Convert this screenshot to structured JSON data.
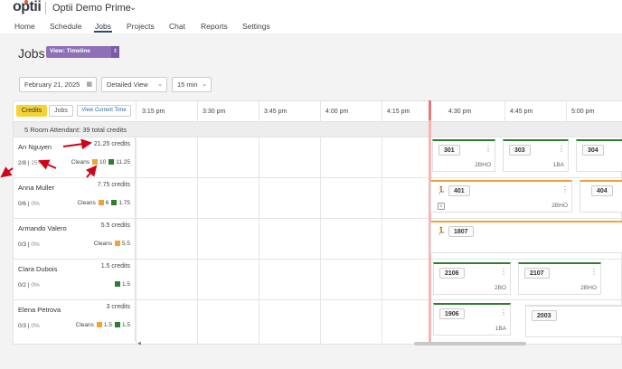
{
  "app": {
    "logo_text": "optii",
    "org_name": "Optii Demo Prime"
  },
  "nav": {
    "items": [
      {
        "label": "Home"
      },
      {
        "label": "Schedule"
      },
      {
        "label": "Jobs"
      },
      {
        "label": "Projects"
      },
      {
        "label": "Chat"
      },
      {
        "label": "Reports"
      },
      {
        "label": "Settings"
      }
    ],
    "active": "Jobs"
  },
  "page": {
    "title": "Jobs",
    "view_label": "View: Timeline"
  },
  "controls": {
    "date": "February 21, 2025",
    "detail": "Detailed View",
    "interval": "15 min"
  },
  "timeline": {
    "tabs": {
      "credits": "Credits",
      "jobs": "Jobs",
      "view_current": "View Current Time"
    },
    "times": [
      "3:15 pm",
      "3:30 pm",
      "3:45 pm",
      "4:00 pm",
      "4:15 pm",
      "4:30 pm",
      "4:45 pm",
      "5:00 pm"
    ],
    "group_label": "5 Room Attendant: 39 total credits",
    "staff": [
      {
        "name": "An Nguyen",
        "credits": "21.25 credits",
        "progress": "2/8",
        "percent": "25%",
        "cleans_label": "Cleans",
        "orange": "10",
        "green": "11.25"
      },
      {
        "name": "Anna Muller",
        "credits": "7.75 credits",
        "progress": "0/6",
        "percent": "0%",
        "cleans_label": "Cleans",
        "orange": "6",
        "green": "1.75"
      },
      {
        "name": "Armando Valero",
        "credits": "5.5 credits",
        "progress": "0/3",
        "percent": "0%",
        "cleans_label": "Cleans",
        "orange": "5.5",
        "green": ""
      },
      {
        "name": "Clara Dubois",
        "credits": "1.5 credits",
        "progress": "0/2",
        "percent": "0%",
        "cleans_label": "",
        "orange": "",
        "green": "1.5"
      },
      {
        "name": "Elena Petrova",
        "credits": "3 credits",
        "progress": "0/3",
        "percent": "0%",
        "cleans_label": "Cleans",
        "orange": "1.5",
        "green": "1.5"
      }
    ],
    "jobs": {
      "r1": [
        {
          "room": "301",
          "type": "2BHO"
        },
        {
          "room": "303",
          "type": "1BA"
        },
        {
          "room": "304",
          "type": ""
        }
      ],
      "r2": [
        {
          "room": "401",
          "type": "2BHO"
        },
        {
          "room": "404",
          "type": ""
        }
      ],
      "r3": [
        {
          "room": "1807",
          "type": ""
        }
      ],
      "r4": [
        {
          "room": "2106",
          "type": "2BO"
        },
        {
          "room": "2107",
          "type": "2BHO"
        }
      ],
      "r5": [
        {
          "room": "1906",
          "type": "1BA"
        },
        {
          "room": "2003",
          "type": ""
        }
      ]
    }
  },
  "colors": {
    "accent_purple": "#8e6fb8",
    "credits_yellow": "#f5d332",
    "green": "#2e7d32",
    "orange": "#f0a33a",
    "annotation_red": "#d0021b",
    "now_line": "#f7b6b6"
  }
}
